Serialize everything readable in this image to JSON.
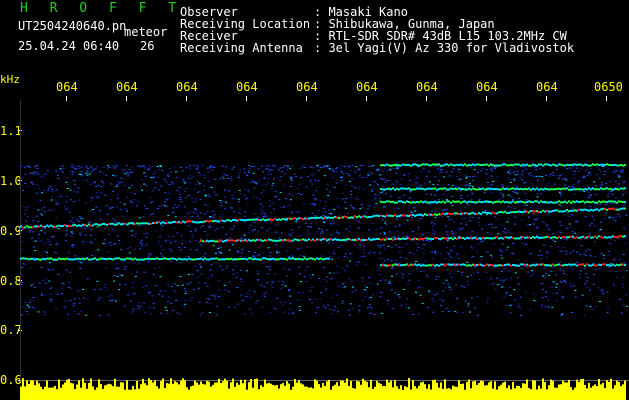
{
  "header": {
    "brand": "H R O F F T",
    "filename": "UT2504240640.pn",
    "tag": "meteor",
    "datetime": "25.04.24 06:40",
    "count": "26",
    "fields": [
      {
        "label": "Observer",
        "value": ": Masaki Kano"
      },
      {
        "label": "Receiving Location",
        "value": ": Shibukawa, Gunma, Japan"
      },
      {
        "label": "Receiver",
        "value": ": RTL-SDR SDR# 43dB L15 103.2MHz CW"
      },
      {
        "label": "Receiving Antenna",
        "value": ": 3el Yagi(V) Az 330 for Vladivostok"
      }
    ]
  },
  "axes": {
    "unit": "kHz",
    "x_ticks": [
      "064",
      "064",
      "064",
      "064",
      "064",
      "064",
      "064",
      "064",
      "064",
      "0650"
    ],
    "y_ticks": [
      "1.1",
      "1.0",
      "0.9",
      "0.8",
      "0.7",
      "0.6"
    ]
  },
  "colors": {
    "background": "#000000",
    "noise": "#1a3cff",
    "signal": "#00e0ff",
    "peak": "#ff2020",
    "mid": "#20ff40",
    "labels": "#ffff00",
    "brand": "#20d020",
    "power_bar": "#ffff00"
  }
}
